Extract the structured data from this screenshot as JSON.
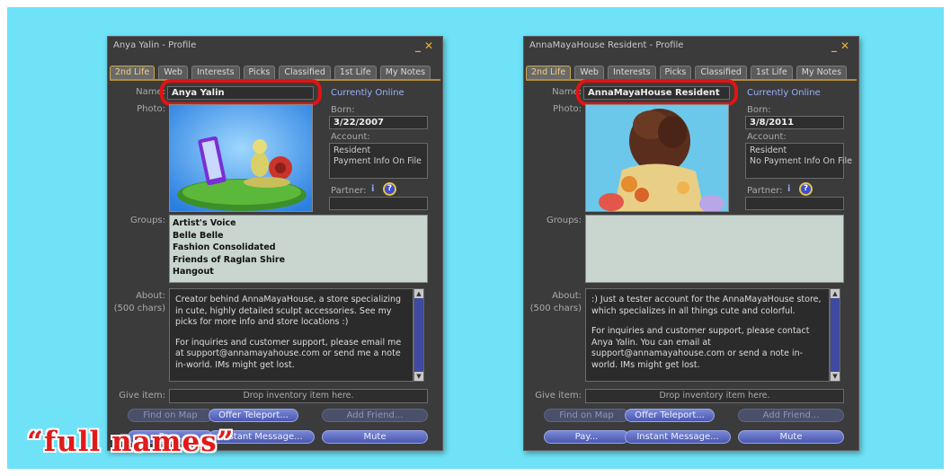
{
  "caption": "“full names”",
  "common": {
    "tabs": [
      "2nd Life",
      "Web",
      "Interests",
      "Picks",
      "Classified",
      "1st Life",
      "My Notes"
    ],
    "name_label": "Name:",
    "photo_label": "Photo:",
    "born_label": "Born:",
    "account_label": "Account:",
    "partner_label": "Partner:",
    "partner_info": "i",
    "partner_help": "?",
    "groups_label": "Groups:",
    "about_label": "About:",
    "about_chars": "(500 chars)",
    "give_item_label": "Give item:",
    "give_item_placeholder": "Drop inventory item here.",
    "buttons": {
      "find_on_map": "Find on Map",
      "offer_teleport": "Offer Teleport...",
      "add_friend": "Add Friend...",
      "pay": "Pay...",
      "instant_message": "Instant Message...",
      "mute": "Mute"
    }
  },
  "left": {
    "title": "Anya Yalin - Profile",
    "name": "Anya Yalin",
    "status": "Currently Online",
    "born": "3/22/2007",
    "account_type": "Resident",
    "payment_info": "Payment Info On File",
    "groups": [
      "Artist's Voice",
      "Belle Belle",
      "Fashion Consolidated",
      "Friends of Raglan Shire",
      "Hangout"
    ],
    "about_p1": "Creator behind AnnaMayaHouse, a store specializing in cute, highly detailed sculpt accessories. See my picks for more info and store locations :)",
    "about_p2": "For inquiries and customer support, please email me at support@annamayahouse.com or send me a note in-world. IMs might get lost."
  },
  "right": {
    "title": "AnnaMayaHouse Resident - Profile",
    "name": "AnnaMayaHouse Resident",
    "status": "Currently Online",
    "born": "3/8/2011",
    "account_type": "Resident",
    "payment_info": "No Payment Info On File",
    "groups": [],
    "about_p1": ":) Just a tester account for the AnnaMayaHouse store, which specializes in all things cute and colorful.",
    "about_p2": "For inquiries and customer support, please contact Anya Yalin. You can email at support@annamayahouse.com or send a note in-world. IMs might get lost."
  },
  "colors": {
    "background": "#6fe2f7",
    "highlight_ring": "#e21313",
    "tab_accent": "#c9a84c"
  }
}
